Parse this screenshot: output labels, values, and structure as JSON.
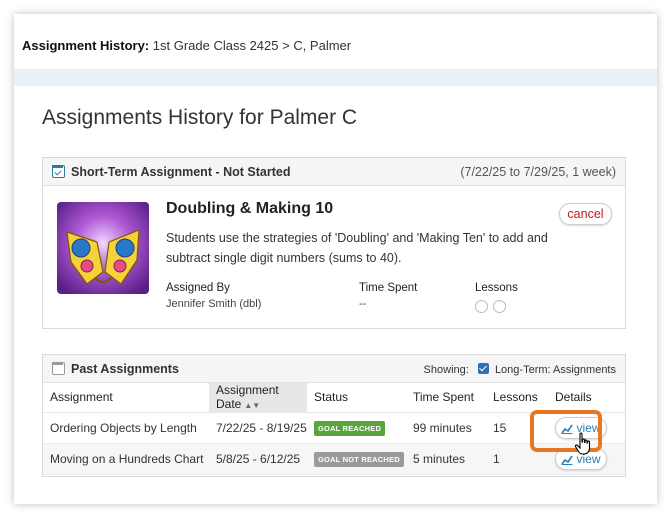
{
  "header": {
    "label": "Assignment History:",
    "breadcrumb": "1st Grade Class 2425 > C, Palmer"
  },
  "page_title": "Assignments History for Palmer C",
  "current_assignment": {
    "header_title": "Short-Term Assignment - Not Started",
    "date_range": "(7/22/25 to 7/29/25, 1 week)",
    "title": "Doubling & Making 10",
    "description": "Students use the strategies of 'Doubling' and 'Making Ten' to add and subtract single digit numbers (sums to 40).",
    "cancel_label": "cancel",
    "assigned_by_label": "Assigned By",
    "assigned_by_value": "Jennifer Smith (dbl)",
    "time_spent_label": "Time Spent",
    "time_spent_value": "--",
    "lessons_label": "Lessons",
    "lessons_total": 2,
    "lessons_completed": 0
  },
  "past_assignments": {
    "header_title": "Past Assignments",
    "showing_label": "Showing:",
    "filter_label": "Long-Term: Assignments",
    "filter_checked": true,
    "columns": [
      "Assignment",
      "Assignment Date",
      "Status",
      "Time Spent",
      "Lessons",
      "Details"
    ],
    "rows": [
      {
        "assignment": "Ordering Objects by Length",
        "date": "7/22/25 - 8/19/25",
        "status": "GOAL REACHED",
        "status_color": "#5aa43f",
        "time_spent": "99 minutes",
        "lessons": "15",
        "details": "view"
      },
      {
        "assignment": "Moving on a Hundreds Chart",
        "date": "5/8/25 - 6/12/25",
        "status": "GOAL NOT REACHED",
        "status_color": "#9a9a9a",
        "time_spent": "5 minutes",
        "lessons": "1",
        "details": "view"
      }
    ]
  },
  "colors": {
    "accent_blue": "#2b7a9f",
    "cancel_red": "#c4161c",
    "highlight_orange": "#e87722"
  }
}
